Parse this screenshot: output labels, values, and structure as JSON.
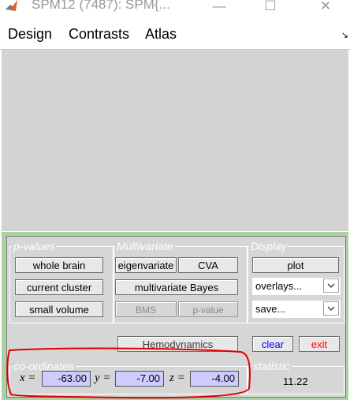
{
  "window": {
    "title": "SPM12 (7487): SPM{...",
    "minimize_glyph": "—",
    "maximize_glyph": "☐",
    "close_glyph": "✕"
  },
  "menu": {
    "items": [
      "Design",
      "Contrasts",
      "Atlas"
    ],
    "corner_glyph": "↘"
  },
  "pvalues": {
    "legend": "p-values",
    "whole_brain": "whole brain",
    "current_cluster": "current cluster",
    "small_volume": "small volume"
  },
  "multivariate": {
    "legend": "Multivariate",
    "eigenvariate": "eigenvariate",
    "cva": "CVA",
    "multivariate_bayes": "multivariate Bayes",
    "bms": "BMS",
    "p_value": "p-value"
  },
  "display": {
    "legend": "Display",
    "plot": "plot",
    "overlays": "overlays...",
    "save": "save..."
  },
  "actions": {
    "hemodynamics": "Hemodynamics",
    "clear": "clear",
    "exit": "exit"
  },
  "coordinates": {
    "legend": "co-ordinates",
    "x_label": "x =",
    "x_value": "-63.00",
    "y_label": "y =",
    "y_value": "-7.00",
    "z_label": "z =",
    "z_value": "-4.00"
  },
  "statistic": {
    "legend": "statistic",
    "value": "11.22"
  },
  "colors": {
    "panel_green": "#abd0a2",
    "panel_gray": "#d6d6d6",
    "coord_box": "#ccccff",
    "annotation_red": "#e00000"
  }
}
